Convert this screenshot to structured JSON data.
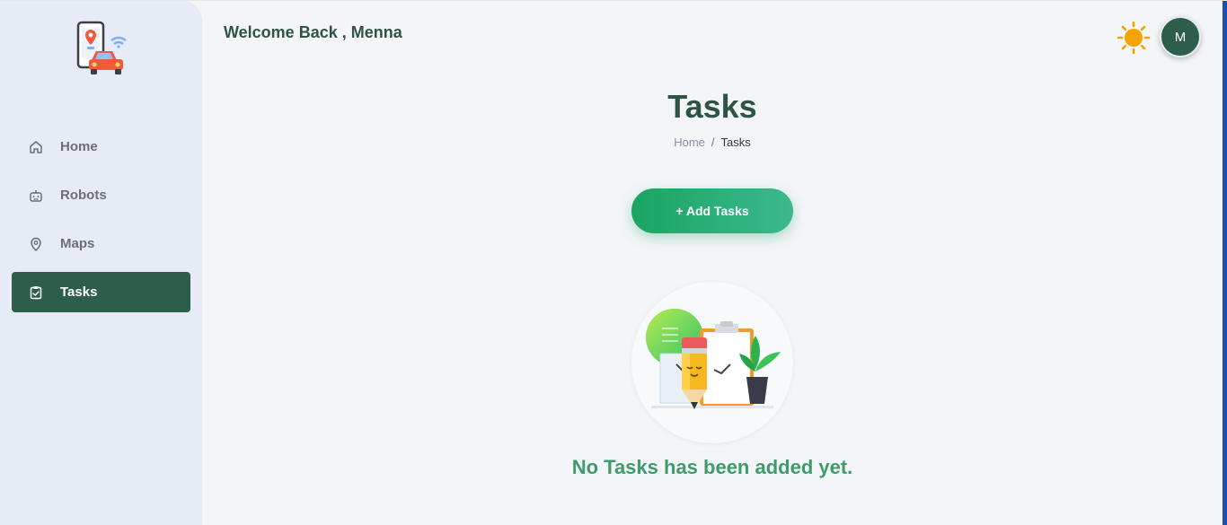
{
  "header": {
    "welcome": "Welcome Back , Menna",
    "avatar_initial": "M"
  },
  "sidebar": {
    "items": [
      {
        "label": "Home",
        "icon": "home-icon",
        "active": false
      },
      {
        "label": "Robots",
        "icon": "robot-icon",
        "active": false
      },
      {
        "label": "Maps",
        "icon": "map-pin-icon",
        "active": false
      },
      {
        "label": "Tasks",
        "icon": "clipboard-check-icon",
        "active": true
      }
    ]
  },
  "main": {
    "title": "Tasks",
    "breadcrumb": {
      "home": "Home",
      "separator": "/",
      "current": "Tasks"
    },
    "add_button": "+ Add Tasks",
    "empty_message": "No Tasks has been added yet."
  },
  "colors": {
    "primary": "#2d5e4c",
    "accent_green": "#1aa563",
    "sidebar_bg": "#e7ebf6",
    "empty_text": "#3f9b6a",
    "sun": "#f5a300"
  }
}
